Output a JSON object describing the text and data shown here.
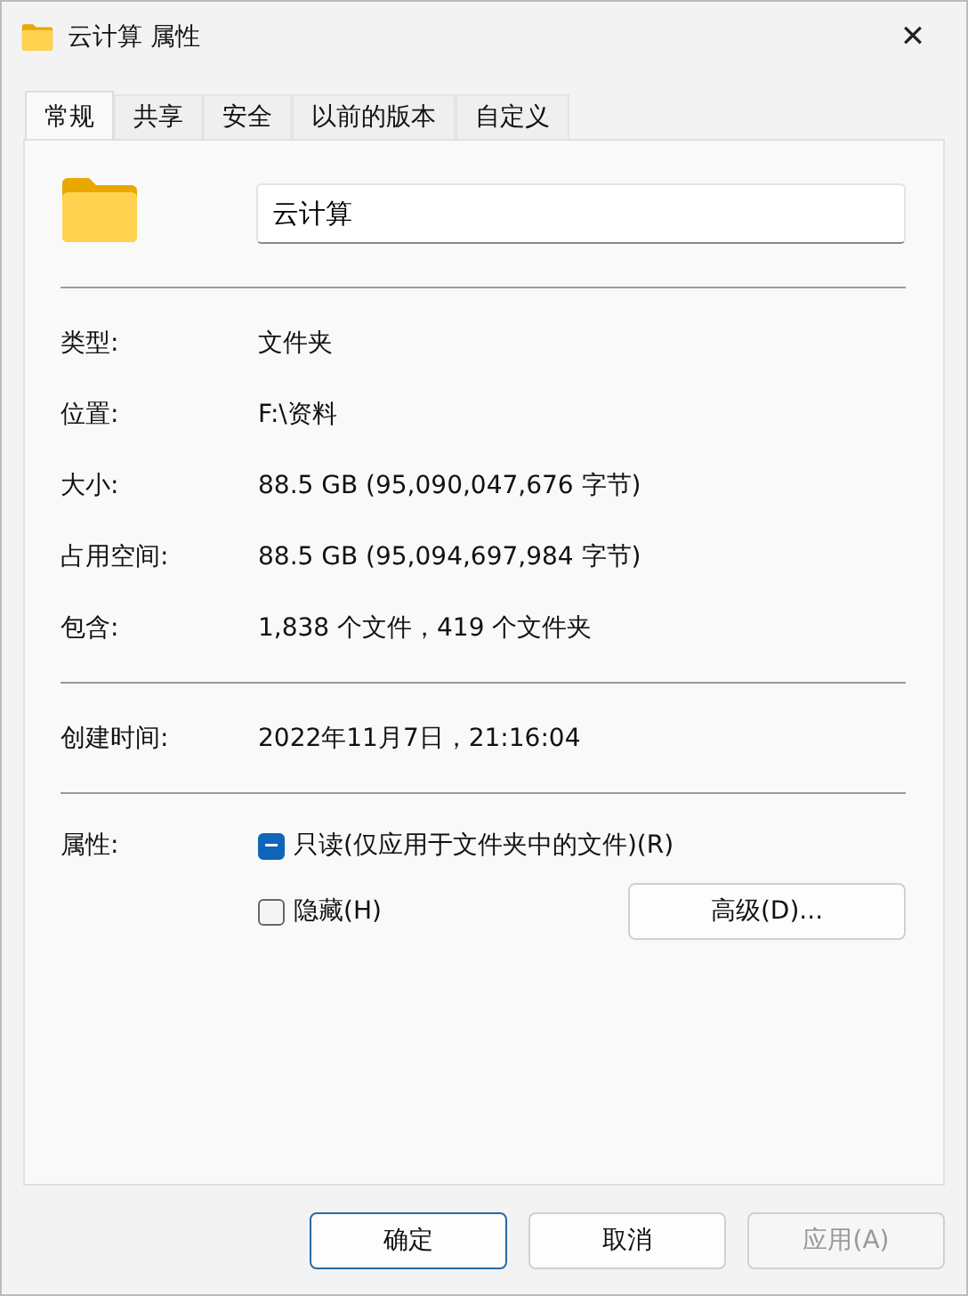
{
  "window": {
    "title": "云计算 属性",
    "close": "✕"
  },
  "tabs": [
    {
      "label": "常规",
      "selected": true
    },
    {
      "label": "共享",
      "selected": false
    },
    {
      "label": "安全",
      "selected": false
    },
    {
      "label": "以前的版本",
      "selected": false
    },
    {
      "label": "自定义",
      "selected": false
    }
  ],
  "name_field": {
    "value": "云计算"
  },
  "info_groups": [
    [
      {
        "label": "类型:",
        "value": "文件夹"
      },
      {
        "label": "位置:",
        "value": "F:\\资料"
      },
      {
        "label": "大小:",
        "value": "88.5 GB (95,090,047,676 字节)"
      },
      {
        "label": "占用空间:",
        "value": "88.5 GB (95,094,697,984 字节)"
      },
      {
        "label": "包含:",
        "value": "1,838 个文件，419 个文件夹"
      }
    ],
    [
      {
        "label": "创建时间:",
        "value": "2022年11月7日，21:16:04"
      }
    ]
  ],
  "attributes": {
    "label": "属性:",
    "options": [
      {
        "label": "只读(仅应用于文件夹中的文件)(R)",
        "indeterminate": true
      },
      {
        "label": "隐藏(H)",
        "checked": false,
        "indeterminate": false
      }
    ],
    "advanced_button": "高级(D)..."
  },
  "buttons": [
    {
      "label": "确定",
      "kind": "default",
      "disabled": false
    },
    {
      "label": "取消",
      "kind": "normal",
      "disabled": false
    },
    {
      "label": "应用(A)",
      "kind": "normal",
      "disabled": true
    }
  ]
}
